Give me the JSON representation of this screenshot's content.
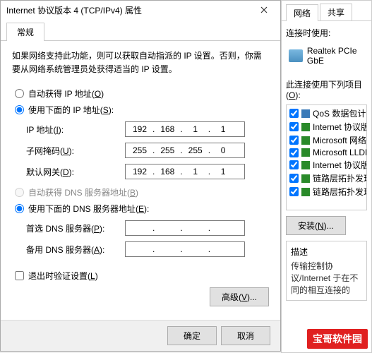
{
  "dialog": {
    "title": "Internet 协议版本 4 (TCP/IPv4) 属性",
    "tab_general": "常规",
    "description": "如果网络支持此功能，则可以获取自动指派的 IP 设置。否则，你需要从网络系统管理员处获得适当的 IP 设置。",
    "ip_auto": "自动获得 IP 地址(",
    "ip_auto_key": "O",
    "ip_manual": "使用下面的 IP 地址(",
    "ip_manual_key": "S",
    "ip_address_label": "IP 地址(",
    "ip_address_key": "I",
    "subnet_label": "子网掩码(",
    "subnet_key": "U",
    "gateway_label": "默认网关(",
    "gateway_key": "D",
    "ip_address": {
      "a": "192",
      "b": "168",
      "c": "1",
      "d": "1"
    },
    "subnet": {
      "a": "255",
      "b": "255",
      "c": "255",
      "d": "0"
    },
    "gateway": {
      "a": "192",
      "b": "168",
      "c": "1",
      "d": "1"
    },
    "dns_auto": "自动获得 DNS 服务器地址(",
    "dns_auto_key": "B",
    "dns_manual": "使用下面的 DNS 服务器地址(",
    "dns_manual_key": "E",
    "dns_pref_label": "首选 DNS 服务器(",
    "dns_pref_key": "P",
    "dns_alt_label": "备用 DNS 服务器(",
    "dns_alt_key": "A",
    "validate_label": "退出时验证设置(",
    "validate_key": "L",
    "advanced": "高级(",
    "advanced_key": "V",
    "ok": "确定",
    "cancel": "取消"
  },
  "bg": {
    "tab_network": "网络",
    "tab_share": "共享",
    "connect_using": "连接时使用:",
    "adapter": "Realtek PCIe GbE",
    "items_label": "此连接使用下列项目(",
    "items_key": "O",
    "items": [
      {
        "label": "QoS 数据包计划",
        "icon": "blue"
      },
      {
        "label": "Internet 协议版本",
        "icon": "green"
      },
      {
        "label": "Microsoft 网络适",
        "icon": "green"
      },
      {
        "label": "Microsoft LLDP",
        "icon": "green"
      },
      {
        "label": "Internet 协议版本",
        "icon": "green"
      },
      {
        "label": "链路层拓扑发现",
        "icon": "green"
      },
      {
        "label": "链路层拓扑发现",
        "icon": "green"
      }
    ],
    "install": "安装(",
    "install_key": "N",
    "desc_title": "描述",
    "desc_text": "传输控制协议/Internet 于在不同的相互连接的"
  },
  "watermark": "宝哥软件园"
}
